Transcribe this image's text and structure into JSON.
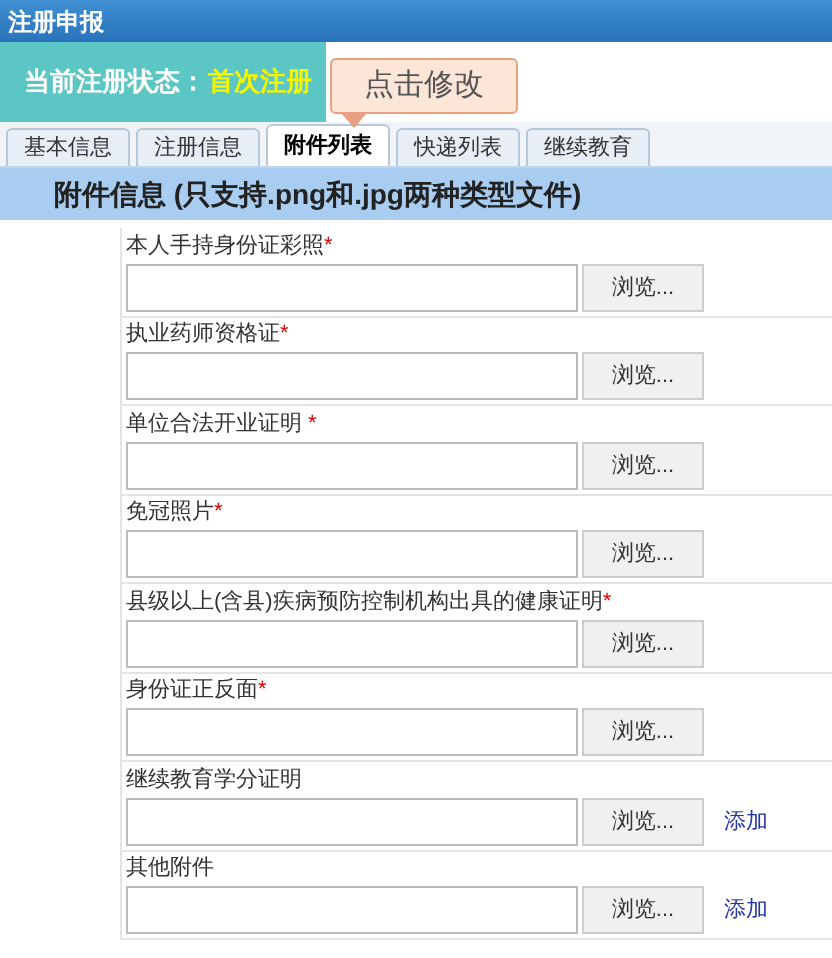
{
  "window": {
    "title": "注册申报"
  },
  "status": {
    "label": "当前注册状态：",
    "value": "首次注册"
  },
  "callout": "点击修改",
  "tabs": [
    {
      "label": "基本信息",
      "selected": false
    },
    {
      "label": "注册信息",
      "selected": false
    },
    {
      "label": "附件列表",
      "selected": true
    },
    {
      "label": "快递列表",
      "selected": false
    },
    {
      "label": "继续教育",
      "selected": false
    }
  ],
  "section_title": "附件信息 (只支持.png和.jpg两种类型文件)",
  "attachments": [
    {
      "label": "本人手持身份证彩照",
      "mark": "*",
      "button": "浏览..."
    },
    {
      "label": "执业药师资格证",
      "mark": "*",
      "button": "浏览..."
    },
    {
      "label": "单位合法开业证明",
      "mark": " *",
      "button": "浏览..."
    },
    {
      "label": "免冠照片",
      "mark": "*",
      "button": "浏览..."
    },
    {
      "label": "县级以上(含县)疾病预防控制机构出具的健康证明",
      "mark": "*",
      "button": "浏览..."
    },
    {
      "label": "身份证正反面",
      "mark": "*",
      "button": "浏览..."
    },
    {
      "label": "继续教育学分证明",
      "button": "浏览...",
      "action": "添加"
    },
    {
      "label": "其他附件",
      "button": "浏览...",
      "action": "添加"
    }
  ]
}
